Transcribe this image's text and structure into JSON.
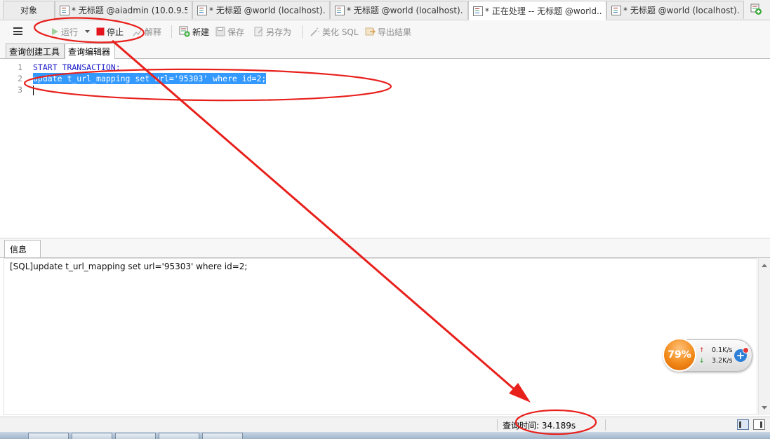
{
  "tabs": [
    {
      "label": "对象",
      "type": "objects"
    },
    {
      "label": "* 无标题 @aiadmin (10.0.9.5...",
      "type": "query"
    },
    {
      "label": "* 无标题 @world (localhost)...",
      "type": "query"
    },
    {
      "label": "* 无标题 @world (localhost)...",
      "type": "query"
    },
    {
      "label": "* 正在处理 -- 无标题 @world...",
      "type": "query",
      "active": true
    },
    {
      "label": "* 无标题 @world (localhost)...",
      "type": "query"
    }
  ],
  "toolbar": {
    "run_label": "运行",
    "stop_label": "停止",
    "explain_label": "解释",
    "new_label": "新建",
    "save_label": "保存",
    "save_as_label": "另存为",
    "beautify_label": "美化 SQL",
    "export_label": "导出结果"
  },
  "subtabs": {
    "builder_label": "查询创建工具",
    "editor_label": "查询编辑器"
  },
  "editor": {
    "lines": [
      {
        "num": "1",
        "text": "START TRANSACTION;"
      },
      {
        "num": "2",
        "text": "update t_url_mapping set url='95303' where id=2;"
      },
      {
        "num": "3",
        "text": ""
      }
    ]
  },
  "info": {
    "tab_label": "信息",
    "message": "[SQL]update t_url_mapping set url='95303' where id=2;"
  },
  "speed_widget": {
    "percent": "79%",
    "upload": "0.1K/s",
    "download": "3.2K/s",
    "plus": "+"
  },
  "status": {
    "query_time": "查询时间: 34.189s"
  },
  "colors": {
    "selection": "#3399ff",
    "annotation": "#e8201c",
    "keyword": "#1c1cc8"
  }
}
